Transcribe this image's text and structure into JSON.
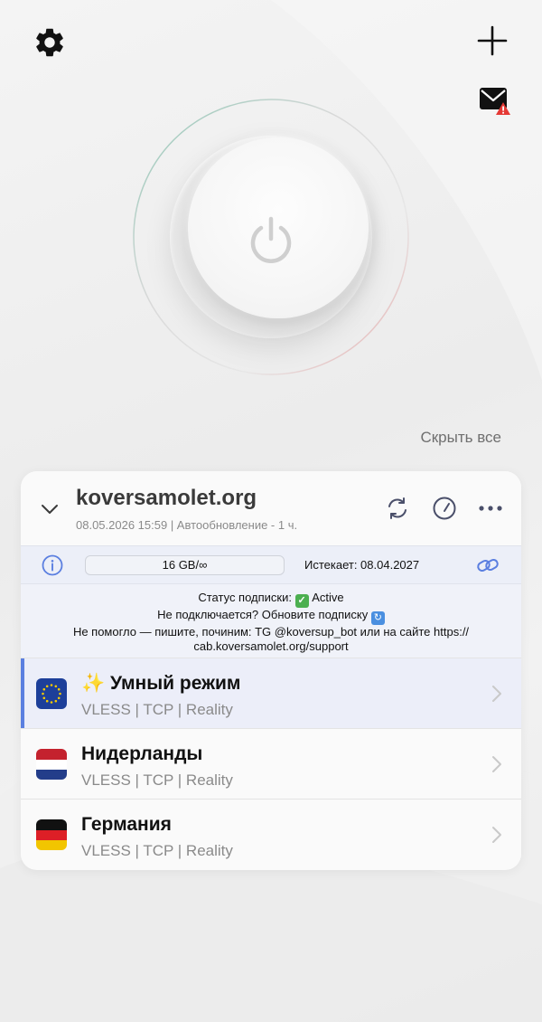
{
  "header": {
    "settings_icon": "gear-icon",
    "add_icon": "plus-icon",
    "mail_icon": "mail-alert-icon"
  },
  "power": {
    "state": "off",
    "icon": "power-icon"
  },
  "hide_all_label": "Скрыть все",
  "subscription": {
    "domain": "koversamolet.org",
    "updated": "08.05.2026 15:59 | Автообновление - 1 ч.",
    "quota": "16 GB/∞",
    "expires": "Истекает: 08.04.2027",
    "status_line1_prefix": "Статус подписки:",
    "status_line1_value": "Active",
    "status_line2": "Не подключается? Обновите подписку",
    "status_line3": "Не помогло — пишите, починим: TG @koversup_bot или на сайте https://",
    "status_line4": "cab.koversamolet.org/support"
  },
  "servers": [
    {
      "title": "✨ Умный режим",
      "protocol": "VLESS | TCP | Reality",
      "flag": "eu-flag-icon",
      "selected": true
    },
    {
      "title": "Нидерланды",
      "protocol": "VLESS | TCP | Reality",
      "flag": "nl-flag-icon",
      "selected": false
    },
    {
      "title": "Германия",
      "protocol": "VLESS | TCP | Reality",
      "flag": "de-flag-icon",
      "selected": false
    }
  ],
  "colors": {
    "accent": "#5b7fe0",
    "selected_row": "#eceef9",
    "status_bg": "#f0f2f9"
  }
}
